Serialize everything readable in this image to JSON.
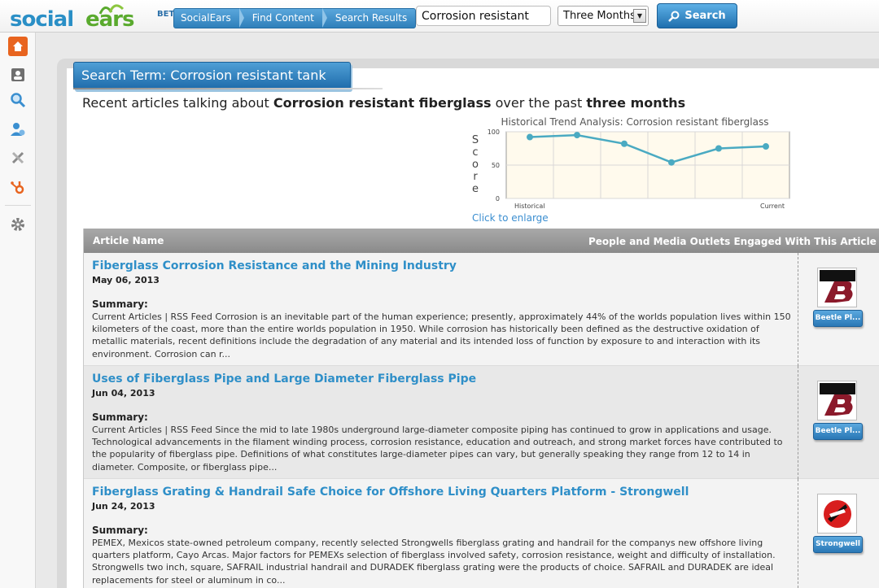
{
  "brand": {
    "social": "social",
    "ears": "ears",
    "beta": "BETA",
    "accent_blue": "#2a8fc6",
    "accent_green": "#5aaa2e"
  },
  "breadcrumbs": [
    "SocialEars",
    "Find Content",
    "Search Results"
  ],
  "search": {
    "value": "Corrosion resistant",
    "range": "Three Months",
    "button": "Search"
  },
  "rail": {
    "icons": [
      "home-icon",
      "contacts-icon",
      "search-icon",
      "user-settings-icon",
      "tools-icon",
      "hubspot-icon",
      "gear-icon"
    ]
  },
  "term": {
    "label": "Search Term: Corrosion resistant tank"
  },
  "subhead": {
    "pre": "Recent articles talking about ",
    "term": "Corrosion resistant fiberglass",
    "mid": " over the past ",
    "period": "three months"
  },
  "chart_link": "Click to enlarge",
  "chart_data": {
    "type": "line",
    "title": "Historical Trend Analysis: Corrosion resistant fiberglass",
    "ylabel": "Score",
    "xlabel": "",
    "x_tick_labels": [
      "Historical",
      "Current"
    ],
    "y_ticks": [
      0,
      50,
      100
    ],
    "ylim": [
      0,
      100
    ],
    "grid": true,
    "series": [
      {
        "values": [
          92,
          95,
          82,
          54,
          75,
          78
        ],
        "color": "#4aaac2"
      }
    ]
  },
  "table": {
    "col_name": "Article Name",
    "col_people": "People and Media Outlets Engaged With This Article",
    "rows": [
      {
        "title": "Fiberglass Corrosion Resistance and the Mining Industry",
        "date": "May 06, 2013",
        "summary_label": "Summary:",
        "summary": "Current Articles | RSS Feed Corrosion is an inevitable part of the human experience; presently, approximately 44% of the worlds population lives within 150 kilometers of the coast, more than the entire worlds population in 1950. While corrosion has historically been defined as the destructive oxidation of metallic materials, recent definitions include the degradation of any material and its intended loss of function by exposure to and interaction with its environment. Corrosion can r...",
        "outlet": "Beetle Pl..."
      },
      {
        "title": "Uses of Fiberglass Pipe and Large Diameter Fiberglass Pipe",
        "date": "Jun 04, 2013",
        "summary_label": "Summary:",
        "summary": "Current Articles | RSS Feed Since the mid to late 1980s underground large-diameter composite piping has continued to grow in applications and usage. Technological advancements in the filament winding process, corrosion resistance, education and outreach, and strong market forces have contributed to the popularity of fiberglass pipe. Definitions of what constitutes large-diameter pipes can vary, but generally speaking they range from 12 to 14 in diameter. Composite, or fiberglass pipe...",
        "outlet": "Beetle Pl..."
      },
      {
        "title": "Fiberglass Grating & Handrail Safe Choice for Offshore Living Quarters Platform - Strongwell",
        "date": "Jun 24, 2013",
        "summary_label": "Summary:",
        "summary": "PEMEX, Mexicos state-owned petroleum company, recently selected Strongwells fiberglass grating and handrail for the companys new offshore living quarters platform, Cayo Arcas. Major factors for PEMEXs selection of fiberglass involved safety, corrosion resistance, weight and difficulty of installation. Strongwells two inch, square, SAFRAIL industrial handrail and DURADEK fiberglass grating were the products of choice. SAFRAIL and DURADEK are ideal replacements for steel or aluminum in co...",
        "outlet": "Strongwell"
      }
    ]
  }
}
